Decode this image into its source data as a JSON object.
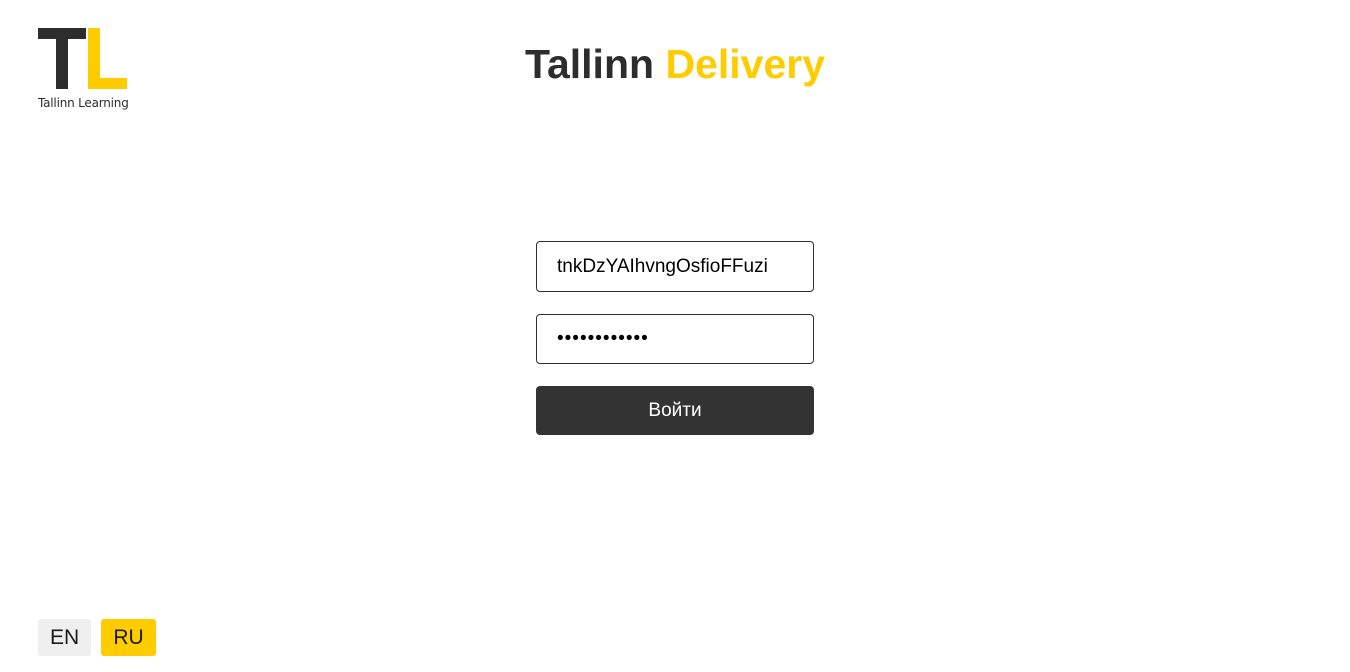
{
  "logo": {
    "letters": "TL",
    "caption": "Tallinn Learning",
    "colors": {
      "dark": "#2d2d2d",
      "accent": "#ffcc00"
    }
  },
  "header": {
    "title_part1": "Tallinn",
    "title_part2": "Delivery"
  },
  "login_form": {
    "username_value": "tnkDzYAIhvngOsfioFFuzi",
    "password_value": "••••••••••••",
    "submit_label": "Войти"
  },
  "language": {
    "options": [
      "EN",
      "RU"
    ],
    "selected": "RU"
  },
  "colors": {
    "brand_dark": "#2d2d2d",
    "brand_yellow": "#ffcc00",
    "button_dark": "#333333",
    "lang_inactive_bg": "#efefef"
  }
}
